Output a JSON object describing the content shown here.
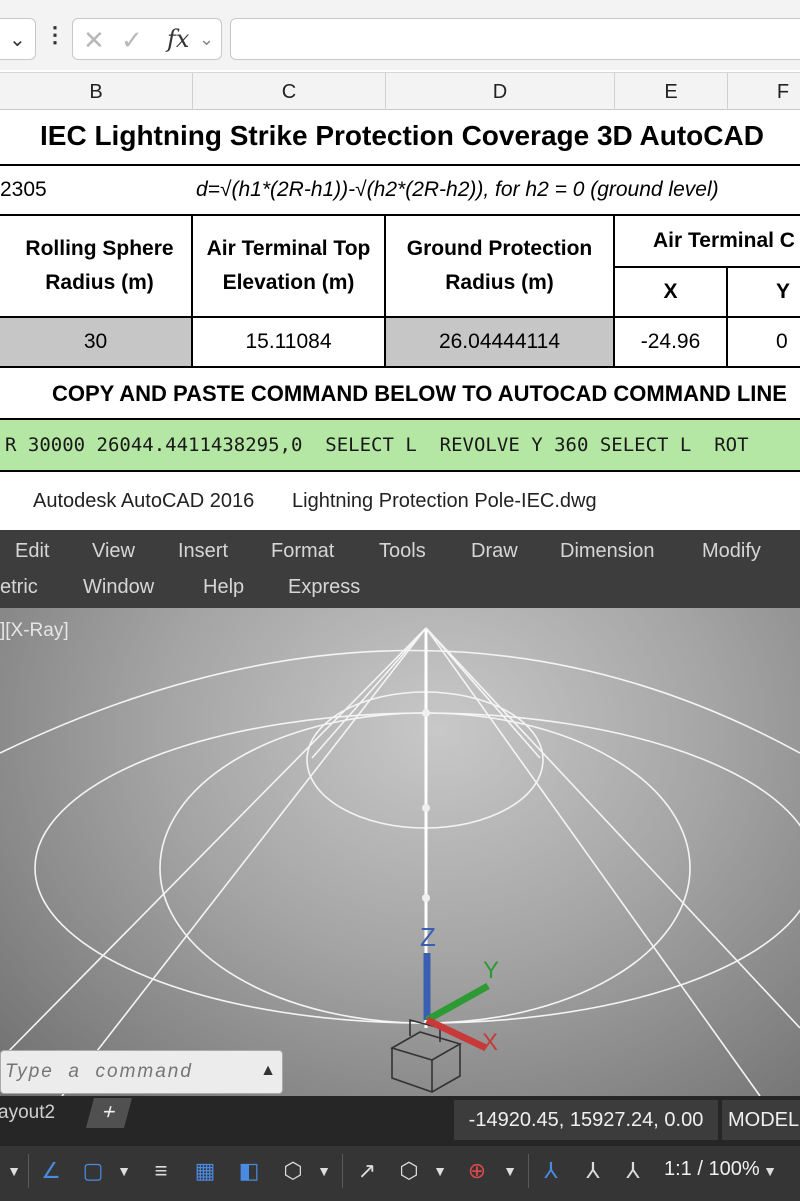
{
  "formula_bar": {
    "fx_label": "fx",
    "cancel_glyph": "✕",
    "confirm_glyph": "✓",
    "input_value": ""
  },
  "columns": [
    "B",
    "C",
    "D",
    "E",
    "F"
  ],
  "sheet": {
    "title": "IEC Lightning Strike Protection Coverage 3D AutoCAD",
    "row_value_b": "2305",
    "formula_note": "d=√(h1*(2R-h1))-√(h2*(2R-h2)), for h2 = 0 (ground level)",
    "headers": {
      "rolling_sphere": "Rolling Sphere Radius (m)",
      "air_terminal_top": "Air Terminal Top Elevation (m)",
      "ground_protection": "Ground Protection Radius (m)",
      "air_terminal_coord": "Air Terminal C",
      "x": "X",
      "y": "Y"
    },
    "values": {
      "rolling_sphere": "30",
      "air_terminal_top": "15.11084",
      "ground_protection": "26.04444114",
      "x": "-24.96",
      "y": "0"
    },
    "command_heading": "COPY AND PASTE COMMAND BELOW TO AUTOCAD COMMAND LINE",
    "command_line": "R 30000 26044.4411438295,0  SELECT L  REVOLVE Y 360 SELECT L  ROT"
  },
  "autocad": {
    "app_name": "Autodesk AutoCAD 2016",
    "file_name": "Lightning Protection Pole-IEC.dwg",
    "menu_row1": [
      "Edit",
      "View",
      "Insert",
      "Format",
      "Tools",
      "Draw",
      "Dimension",
      "Modify"
    ],
    "menu_row2": [
      "etric",
      "Window",
      "Help",
      "Express"
    ],
    "viewport_label": "][X-Ray]",
    "axis_labels": {
      "z": "Z",
      "y": "Y",
      "x": "X"
    },
    "command_placeholder": "Type  a  command",
    "layout_tab": "ayout2",
    "add_tab": "+",
    "coordinates": "-14920.45, 15927.24, 0.00",
    "model_button": "MODEL",
    "zoom_ratio": "1:1 / 100%",
    "colors": {
      "menu_bg": "#3d3d3d",
      "status_bg": "#262626",
      "command_row_green": "#b4e6a4",
      "highlight_cell": "#c6c6c6"
    }
  }
}
